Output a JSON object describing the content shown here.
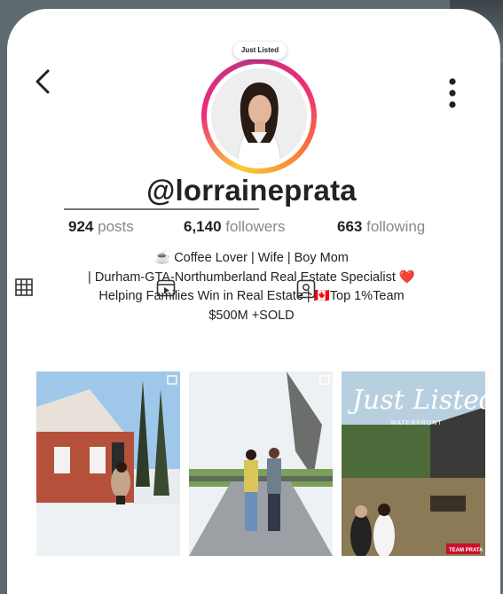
{
  "profile": {
    "username": "@lorraineprata",
    "avatar_note": "Just Listed",
    "stats": {
      "posts_count": "924",
      "posts_label": "posts",
      "followers_count": "6,140",
      "followers_label": "followers",
      "following_count": "663",
      "following_label": "following"
    },
    "bio": [
      "☕ Coffee Lover | Wife | Boy Mom",
      "| Durham-GTA-Northumberland Real Estate Specialist ❤️",
      "Helping Families Win in Real Estate | 🇨🇦Top 1%Team",
      "$500M +SOLD"
    ]
  },
  "posts": [
    {
      "icon": "post-type-icon"
    },
    {
      "icon": "post-type-icon"
    },
    {
      "headline": "Just Listed",
      "subline": "WATERFRONT",
      "badge": "TEAM PRATA"
    }
  ],
  "icons": {
    "back": "chevron-left-icon",
    "more": "more-vertical-icon",
    "grid": "grid-icon",
    "reels": "reels-icon",
    "tagged": "tagged-icon"
  },
  "colors": {
    "ring_gradient": [
      "#f9ce34",
      "#ee2a7b",
      "#c13584"
    ],
    "username": "#222222",
    "stat_label": "#888888"
  }
}
